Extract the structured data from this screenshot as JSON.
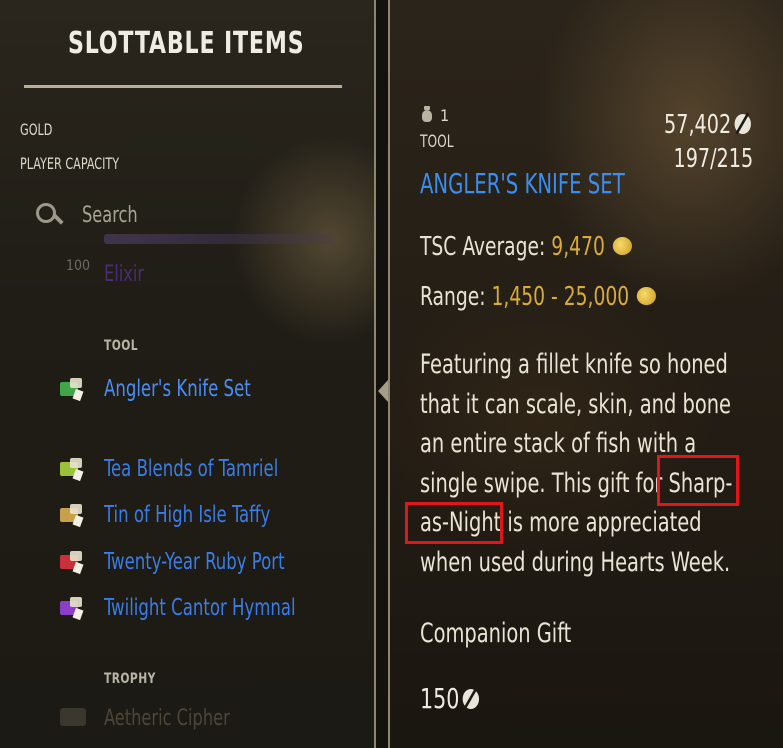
{
  "header": {
    "title": "SLOTTABLE ITEMS"
  },
  "stats": {
    "gold_label": "GOLD",
    "gold_value": "57,402",
    "capacity_label": "PLAYER CAPACITY",
    "capacity_value": "197/215"
  },
  "search": {
    "placeholder": "Search"
  },
  "list": {
    "partial_item": {
      "qty": "100",
      "name": "Elixir"
    },
    "tool_header": "TOOL",
    "tool_items": [
      {
        "name": "Angler's Knife Set",
        "icon_color": "#3fa74a"
      },
      {
        "name": "Tea Blends of Tamriel",
        "icon_color": "#9bc33a"
      },
      {
        "name": "Tin of High Isle Taffy",
        "icon_color": "#c8a04a"
      },
      {
        "name": "Twenty-Year Ruby Port",
        "icon_color": "#c9303a"
      },
      {
        "name": "Twilight Cantor Hymnal",
        "icon_color": "#8a3fc8"
      }
    ],
    "trophy_header": "TROPHY",
    "trophy_partial": "Aetheric Cipher"
  },
  "detail": {
    "quantity": "1",
    "category": "TOOL",
    "name": "ANGLER'S KNIFE SET",
    "tsc_label": "TSC Average: ",
    "tsc_value": "9,470",
    "range_label": "Range: ",
    "range_value": "1,450 - 25,000",
    "description_lines": [
      "Featuring a fillet knife so honed",
      "that it can scale, skin, and bone",
      "an entire stack of fish with a",
      "single swipe. This gift for Sharp-",
      "as-Night is more appreciated",
      "when used during Hearts Week."
    ],
    "companion_label": "Companion Gift",
    "value": "150"
  },
  "colors": {
    "accent_blue": "#3a8ef0",
    "gold_text": "#d8ab3a",
    "highlight_red": "#e0161c"
  }
}
